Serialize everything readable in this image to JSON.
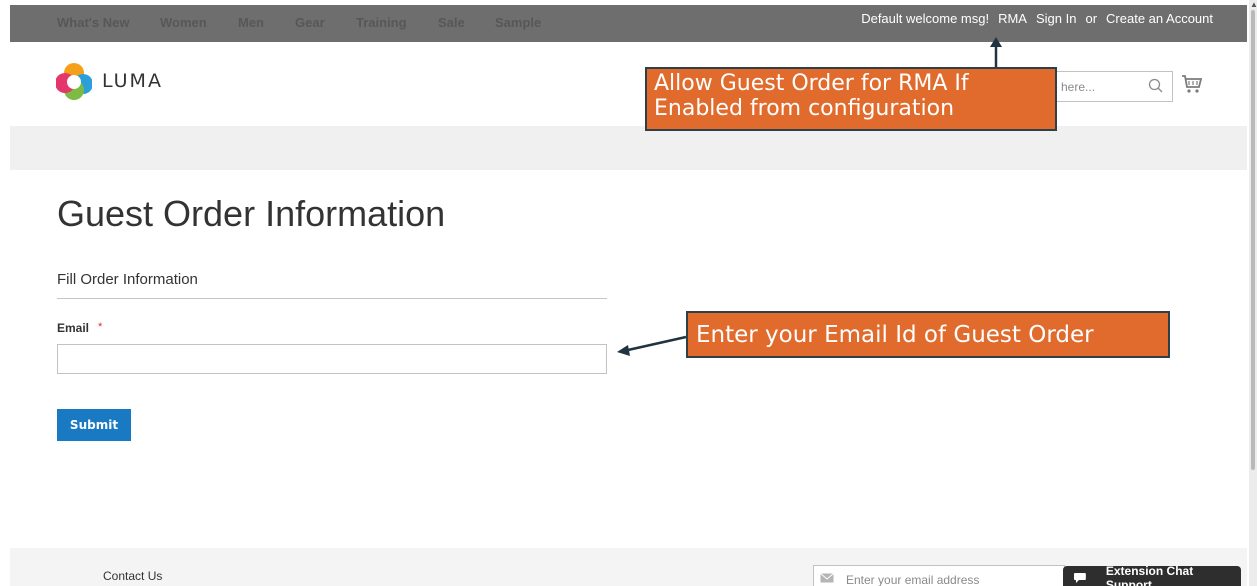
{
  "topbar": {
    "welcome": "Default welcome msg!",
    "rma": "RMA",
    "sign_in": "Sign In",
    "or": "or",
    "create_account": "Create an Account"
  },
  "header": {
    "logo_text": "LUMA",
    "search_placeholder": "e here..."
  },
  "nav": {
    "items": [
      "What's New",
      "Women",
      "Men",
      "Gear",
      "Training",
      "Sale",
      "Sample"
    ]
  },
  "main": {
    "page_title": "Guest Order Information",
    "section_title": "Fill Order Information",
    "email_label": "Email",
    "required_marker": "*",
    "email_value": "",
    "submit_label": "Submit"
  },
  "footer": {
    "contact": "Contact Us",
    "newsletter_placeholder": "Enter your email address",
    "chat_label": "Extension Chat Support"
  },
  "callouts": {
    "rma_note": "Allow Guest Order for RMA If Enabled from configuration",
    "email_note": "Enter your Email Id of Guest Order"
  },
  "colors": {
    "topbar": "#6e6e6e",
    "nav_bg": "#f0f0f0",
    "primary_button": "#1979c3",
    "callout_bg": "#e06b2c",
    "callout_border": "#2f3f47",
    "required": "#e02b27"
  },
  "icons": {
    "logo": "luma-logo-icon",
    "search": "search-icon",
    "cart": "cart-icon",
    "newsletter": "envelope-icon",
    "chat": "chat-bubble-icon"
  }
}
